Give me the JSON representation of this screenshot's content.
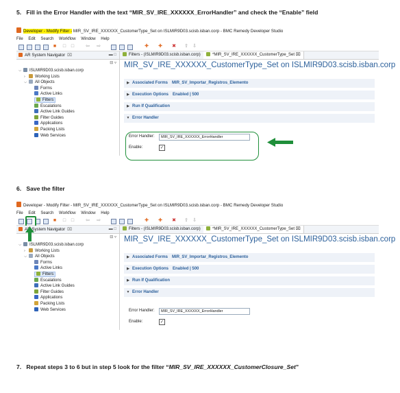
{
  "steps": [
    {
      "number": "5.",
      "text": "Fill in the Error Handler with the text “MIR_SV_IRE_XXXXXX_ErrorHandler” and check the “Enable” field"
    },
    {
      "number": "6.",
      "text": "Save the filter"
    },
    {
      "number": "7.",
      "text_before": "Repeat steps 3 to 6 but in step 5 look for the filter “",
      "filter_name": "MIR_SV_IRE_XXXXXX_CustomerClosure_Set",
      "text_after": "”"
    }
  ],
  "shot1": {
    "title_highlight": "Developer - Modify Filter -",
    "title_rest": " MIR_SV_IRE_XXXXXX_CustomerType_Set on ISLMIR9D03.scisb.isban.corp - BMC Remedy Developer Studio"
  },
  "shot2": {
    "title": "Developer - Modify Filter - MIR_SV_IRE_XXXXXX_CustomerType_Set on ISLMIR9D03.scisb.isban.corp - BMC Remedy Developer Studio"
  },
  "menu": [
    "File",
    "Edit",
    "Search",
    "Workflow",
    "Window",
    "Help"
  ],
  "nav": {
    "tab": "AR System Navigator",
    "tree": {
      "server": "ISLMIR9D03.scisb.isban.corp",
      "working_lists": "Working Lists",
      "all_objects": "All Objects",
      "items": [
        "Forms",
        "Active Links",
        "Filters",
        "Escalations",
        "Active Link Guides",
        "Filter Guides",
        "Applications",
        "Packing Lists",
        "Web Services"
      ]
    }
  },
  "editor": {
    "tab1": "Filters - (ISLMIR9D03.scisb.isban.corp)",
    "tab2": "*MIR_SV_IRE_XXXXXX_CustomerType_Set",
    "title": "MIR_SV_IRE_XXXXXX_CustomerType_Set on ISLMIR9D03.scisb.isban.corp",
    "sections": {
      "associated_forms": {
        "label": "Associated Forms",
        "value": "MIR_SV_Importar_Registros_Elemento"
      },
      "execution_options": {
        "label": "Execution Options",
        "value": "Enabled | 500"
      },
      "run_if": {
        "label": "Run If Qualification"
      },
      "error_handler": {
        "label": "Error Handler"
      }
    },
    "fields": {
      "error_handler_label": "Error Handler:",
      "error_handler_value": "MIR_SV_IRE_XXXXXX_ErrorHandler",
      "enable_label": "Enable:",
      "enable_checked": true
    }
  },
  "icons": [
    "app-logo-icon",
    "new-icon",
    "save-icon",
    "close-tab-icon",
    "expand-icon",
    "collapse-icon",
    "form-icon",
    "active-link-icon",
    "filter-icon",
    "arrow-right-icon"
  ],
  "colors": {
    "highlight": "#fff100",
    "annotation": "#1f8f3a",
    "title": "#2b5f9a",
    "section_bg": "#eef2f8"
  }
}
